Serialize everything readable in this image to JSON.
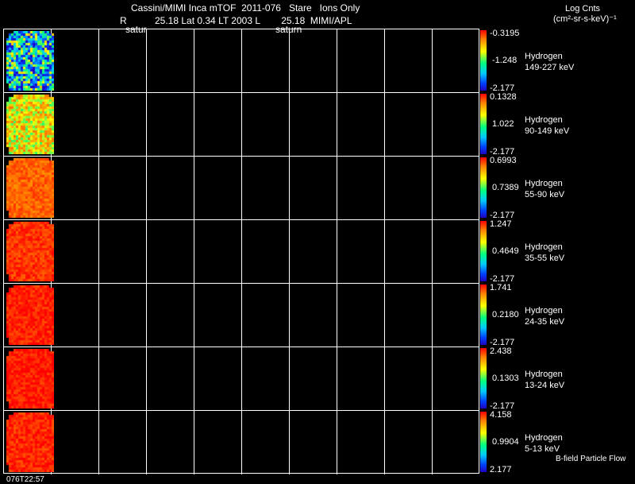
{
  "header": {
    "line1": "Cassini/MIMI Inca mTOF  2011-076   Stare   Ions Only",
    "line2_r": "R",
    "line2_rest": "25.18 Lat 0.34 LT 2003 L        25.18  MIMI/APL",
    "satur_left": "satur",
    "saturn_mid": "saturn"
  },
  "units": {
    "line1": "Log Cnts",
    "line2": "(cm²-sr-s-keV)⁻¹"
  },
  "panels": [
    {
      "species": "Hydrogen",
      "energy": "149-227 keV",
      "max": "-0.3195",
      "mid": "-1.248",
      "min": "-2.177",
      "level": 0.35
    },
    {
      "species": "Hydrogen",
      "energy": "90-149 keV",
      "max": "0.1328",
      "mid": "1.022",
      "min": "-2.177",
      "level": 0.65
    },
    {
      "species": "Hydrogen",
      "energy": "55-90 keV",
      "max": "0.6993",
      "mid": "0.7389",
      "min": "-2.177",
      "level": 0.85
    },
    {
      "species": "Hydrogen",
      "energy": "35-55 keV",
      "max": "1.247",
      "mid": "0.4649",
      "min": "-2.177",
      "level": 0.92
    },
    {
      "species": "Hydrogen",
      "energy": "24-35 keV",
      "max": "1.741",
      "mid": "0.2180",
      "min": "-2.177",
      "level": 0.95
    },
    {
      "species": "Hydrogen",
      "energy": "13-24 keV",
      "max": "2.438",
      "mid": "0.1303",
      "min": "-2.177",
      "level": 0.96
    },
    {
      "species": "Hydrogen",
      "energy": "5-13 keV",
      "max": "4.158",
      "mid": "0.9904",
      "min": "2.177",
      "level": 0.94
    }
  ],
  "footer": {
    "timestamp": "076T22:57",
    "bfield": "B-field Particle Flow"
  }
}
